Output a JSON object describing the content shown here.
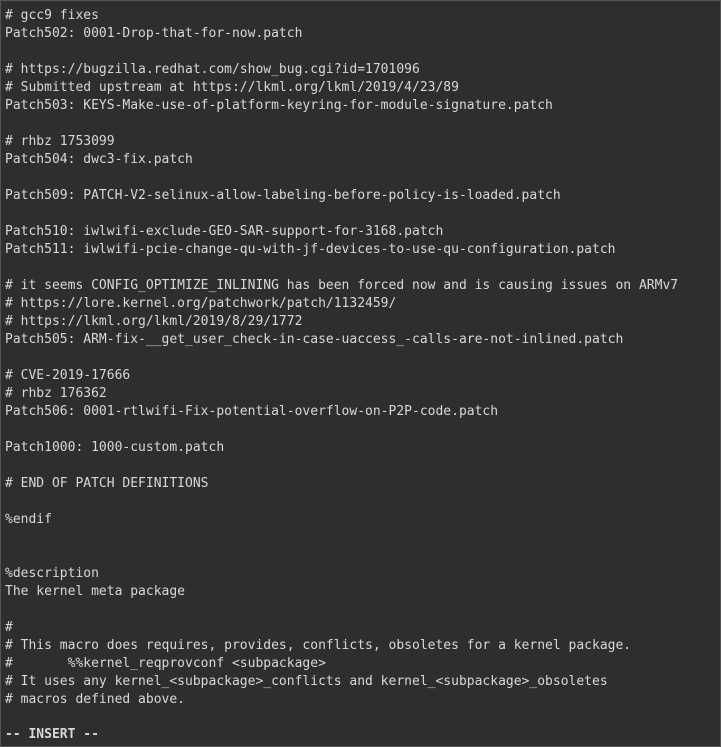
{
  "lines": [
    "# gcc9 fixes",
    "Patch502: 0001-Drop-that-for-now.patch",
    "",
    "# https://bugzilla.redhat.com/show_bug.cgi?id=1701096",
    "# Submitted upstream at https://lkml.org/lkml/2019/4/23/89",
    "Patch503: KEYS-Make-use-of-platform-keyring-for-module-signature.patch",
    "",
    "# rhbz 1753099",
    "Patch504: dwc3-fix.patch",
    "",
    "Patch509: PATCH-V2-selinux-allow-labeling-before-policy-is-loaded.patch",
    "",
    "Patch510: iwlwifi-exclude-GEO-SAR-support-for-3168.patch",
    "Patch511: iwlwifi-pcie-change-qu-with-jf-devices-to-use-qu-configuration.patch",
    "",
    "# it seems CONFIG_OPTIMIZE_INLINING has been forced now and is causing issues on ARMv7",
    "# https://lore.kernel.org/patchwork/patch/1132459/",
    "# https://lkml.org/lkml/2019/8/29/1772",
    "Patch505: ARM-fix-__get_user_check-in-case-uaccess_-calls-are-not-inlined.patch",
    "",
    "# CVE-2019-17666",
    "# rhbz 176362",
    "Patch506: 0001-rtlwifi-Fix-potential-overflow-on-P2P-code.patch",
    "",
    "Patch1000: 1000-custom.patch",
    "",
    "# END OF PATCH DEFINITIONS",
    "",
    "%endif",
    "",
    "",
    "%description",
    "The kernel meta package",
    "",
    "#",
    "# This macro does requires, provides, conflicts, obsoletes for a kernel package.",
    "#       %%kernel_reqprovconf <subpackage>",
    "# It uses any kernel_<subpackage>_conflicts and kernel_<subpackage>_obsoletes",
    "# macros defined above."
  ],
  "status": "-- INSERT --"
}
